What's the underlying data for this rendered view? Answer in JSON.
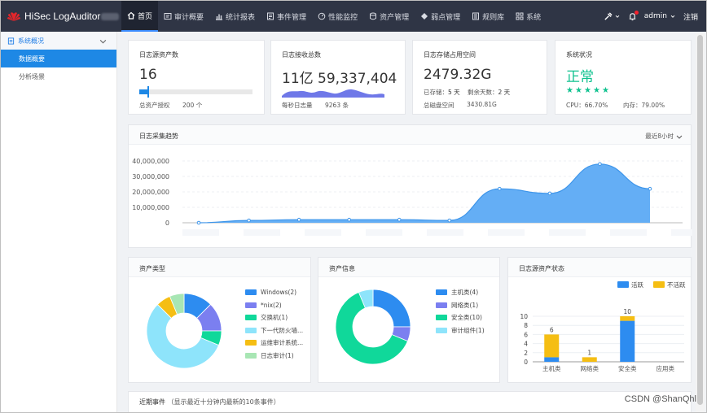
{
  "app": {
    "name": "HiSec LogAuditor"
  },
  "nav": [
    {
      "label": "首页",
      "icon": "home-icon",
      "active": true
    },
    {
      "label": "审计概要",
      "icon": "summary-icon"
    },
    {
      "label": "统计报表",
      "icon": "bar-chart-icon"
    },
    {
      "label": "事件管理",
      "icon": "event-icon"
    },
    {
      "label": "性能监控",
      "icon": "monitor-icon"
    },
    {
      "label": "资产管理",
      "icon": "database-icon"
    },
    {
      "label": "弱点管理",
      "icon": "diamond-icon"
    },
    {
      "label": "规则库",
      "icon": "rules-icon"
    },
    {
      "label": "系统",
      "icon": "grid-icon"
    }
  ],
  "topright": {
    "user": "admin",
    "logout": "注销"
  },
  "sidebar": {
    "group": "系统概况",
    "items": [
      {
        "label": "数据概要",
        "active": true
      },
      {
        "label": "分析场景"
      }
    ]
  },
  "cards": {
    "assets": {
      "title": "日志源资产数",
      "value": "16",
      "license_label": "总资产授权",
      "license_value": "200 个",
      "progress": 0.08
    },
    "received": {
      "title": "日志接收总数",
      "value": "11亿 59,337,404",
      "rate_label": "每秒日志量",
      "rate_value": "9263 条"
    },
    "storage": {
      "title": "日志存储占用空间",
      "value": "2479.32G",
      "stored_label": "已存储：",
      "stored_value": "5 天",
      "remain_label": "剩余天数：",
      "remain_value": "2 天",
      "disk_label": "总磁盘空间",
      "disk_value": "3430.81G"
    },
    "status": {
      "title": "系统状况",
      "value": "正常",
      "cpu": "CPU：66.70%",
      "mem": "内存：79.00%",
      "stars": 5
    }
  },
  "trend": {
    "title": "日志采集趋势",
    "range": "最近8小时"
  },
  "chart_data": [
    {
      "type": "area",
      "title": "日志采集趋势",
      "y_ticks": [
        "40,000,000",
        "30,000,000",
        "20,000,000",
        "10,000,000",
        "0"
      ],
      "ylim": [
        0,
        40000000
      ],
      "values": [
        0,
        1500000,
        2000000,
        2000000,
        2000000,
        1500000,
        22000000,
        19000000,
        38000000,
        22000000
      ],
      "color": "#64aef5"
    },
    {
      "type": "pie",
      "title": "资产类型",
      "labels": [
        "Windows(2)",
        "*nix(2)",
        "交换机(1)",
        "下一代防火墙...",
        "运维审计系统...",
        "日志审计(1)"
      ],
      "values": [
        2,
        2,
        1,
        9,
        1,
        1
      ],
      "colors": [
        "#2d8cf0",
        "#7b7ff0",
        "#10d89a",
        "#8ee4fb",
        "#f5be13",
        "#a8e6b4"
      ]
    },
    {
      "type": "pie",
      "title": "资产信息",
      "labels": [
        "主机类(4)",
        "网络类(1)",
        "安全类(10)",
        "审计组件(1)"
      ],
      "values": [
        4,
        1,
        10,
        1
      ],
      "colors": [
        "#2d8cf0",
        "#7b7ff0",
        "#10d89a",
        "#8ee4fb"
      ]
    },
    {
      "type": "bar",
      "title": "日志源资产状态",
      "categories": [
        "主机类",
        "网络类",
        "安全类",
        "应用类"
      ],
      "series": [
        {
          "name": "活跃",
          "values": [
            1,
            0,
            9,
            0
          ],
          "color": "#2d8cf0"
        },
        {
          "name": "不活跃",
          "values": [
            5,
            1,
            1,
            0
          ],
          "color": "#f5be13"
        }
      ],
      "totals": [
        "6",
        "1",
        "10",
        ""
      ],
      "y_ticks": [
        "10",
        "8",
        "6",
        "4",
        "2",
        "0"
      ],
      "ylim": [
        0,
        10
      ]
    }
  ],
  "events": {
    "title": "近期事件",
    "subtitle": "（显示最近十分钟内最新的10条事件）"
  },
  "watermark": "CSDN @ShanQhl"
}
